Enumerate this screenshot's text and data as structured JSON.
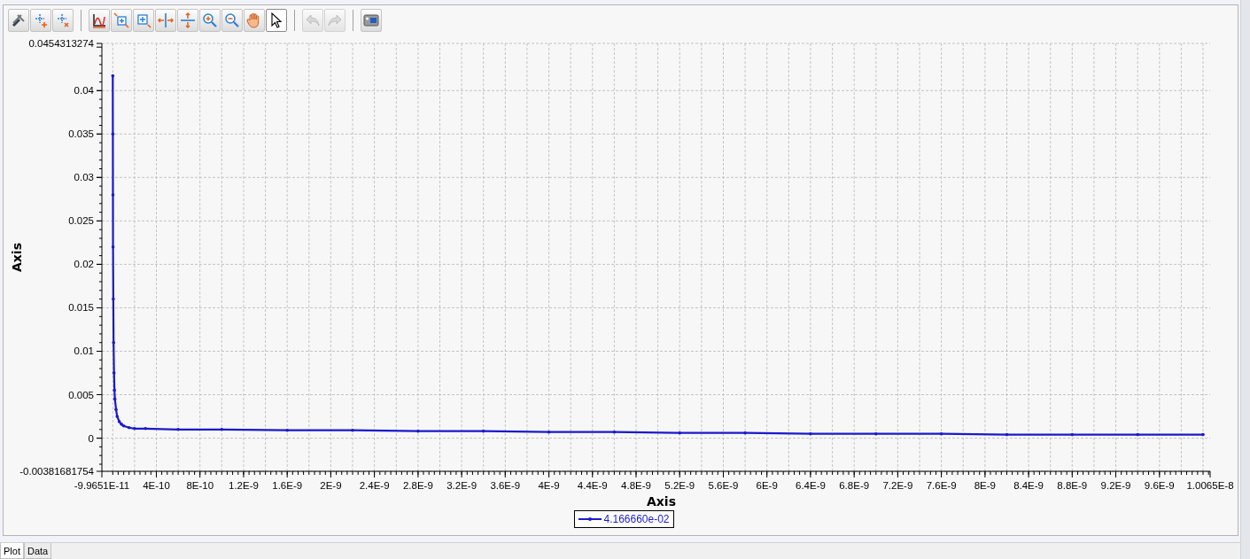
{
  "toolbar": [
    {
      "kind": "tools",
      "selected": false,
      "disabled": false
    },
    {
      "kind": "add-point",
      "selected": false,
      "disabled": false
    },
    {
      "kind": "remove-point",
      "selected": false,
      "disabled": false
    },
    {
      "kind": "sep"
    },
    {
      "kind": "axes",
      "selected": false,
      "disabled": false
    },
    {
      "kind": "zoom-box",
      "selected": false,
      "disabled": false
    },
    {
      "kind": "zoom-box-alt",
      "selected": false,
      "disabled": false
    },
    {
      "kind": "split-h",
      "selected": false,
      "disabled": false
    },
    {
      "kind": "split-v",
      "selected": false,
      "disabled": false
    },
    {
      "kind": "zoom-in",
      "selected": false,
      "disabled": false
    },
    {
      "kind": "zoom-out",
      "selected": false,
      "disabled": false
    },
    {
      "kind": "hand",
      "selected": false,
      "disabled": false
    },
    {
      "kind": "pointer",
      "selected": true,
      "disabled": false
    },
    {
      "kind": "sep"
    },
    {
      "kind": "undo",
      "selected": false,
      "disabled": true
    },
    {
      "kind": "redo",
      "selected": false,
      "disabled": true
    },
    {
      "kind": "sep"
    },
    {
      "kind": "camera",
      "selected": false,
      "disabled": false
    }
  ],
  "chart": {
    "chart_data": {
      "type": "line",
      "xlabel": "Axis",
      "ylabel": "Axis",
      "xlim": [
        -9.9651e-11,
        1.0065e-08
      ],
      "ylim": [
        -0.00381681754,
        0.0454313274
      ],
      "xticks": [
        {
          "value": -9.9651e-11,
          "label": "-9.9651E-11"
        },
        {
          "value": 4e-10,
          "label": "4E-10"
        },
        {
          "value": 8e-10,
          "label": "8E-10"
        },
        {
          "value": 1.2e-09,
          "label": "1.2E-9"
        },
        {
          "value": 1.6e-09,
          "label": "1.6E-9"
        },
        {
          "value": 2e-09,
          "label": "2E-9"
        },
        {
          "value": 2.4e-09,
          "label": "2.4E-9"
        },
        {
          "value": 2.8e-09,
          "label": "2.8E-9"
        },
        {
          "value": 3.2e-09,
          "label": "3.2E-9"
        },
        {
          "value": 3.6e-09,
          "label": "3.6E-9"
        },
        {
          "value": 4e-09,
          "label": "4E-9"
        },
        {
          "value": 4.4e-09,
          "label": "4.4E-9"
        },
        {
          "value": 4.8e-09,
          "label": "4.8E-9"
        },
        {
          "value": 5.2e-09,
          "label": "5.2E-9"
        },
        {
          "value": 5.6e-09,
          "label": "5.6E-9"
        },
        {
          "value": 6e-09,
          "label": "6E-9"
        },
        {
          "value": 6.4e-09,
          "label": "6.4E-9"
        },
        {
          "value": 6.8e-09,
          "label": "6.8E-9"
        },
        {
          "value": 7.2e-09,
          "label": "7.2E-9"
        },
        {
          "value": 7.6e-09,
          "label": "7.6E-9"
        },
        {
          "value": 8e-09,
          "label": "8E-9"
        },
        {
          "value": 8.4e-09,
          "label": "8.4E-9"
        },
        {
          "value": 8.8e-09,
          "label": "8.8E-9"
        },
        {
          "value": 9.2e-09,
          "label": "9.2E-9"
        },
        {
          "value": 9.6e-09,
          "label": "9.6E-9"
        },
        {
          "value": 1.0065e-08,
          "label": "1.0065E-8"
        }
      ],
      "yticks": [
        -0.00381681754,
        0,
        0.005,
        0.01,
        0.015,
        0.02,
        0.025,
        0.03,
        0.035,
        0.04,
        0.0454313274
      ],
      "x": [
        0,
        1e-12,
        2e-12,
        3e-12,
        5e-12,
        8e-12,
        1.2e-11,
        1.6e-11,
        2e-11,
        3e-11,
        4e-11,
        6e-11,
        8e-11,
        1e-10,
        1.5e-10,
        2e-10,
        3e-10,
        6e-10,
        1e-09,
        1.6e-09,
        2.2e-09,
        2.8e-09,
        3.4e-09,
        4e-09,
        4.6e-09,
        5.2e-09,
        5.8e-09,
        6.4e-09,
        7e-09,
        7.6e-09,
        8.2e-09,
        8.8e-09,
        9.4e-09,
        1e-08
      ],
      "series": [
        {
          "name": "4.166660e-02",
          "color": "#1a1acc",
          "values": [
            0.0417,
            0.035,
            0.028,
            0.022,
            0.016,
            0.011,
            0.0075,
            0.0055,
            0.0045,
            0.0033,
            0.0025,
            0.0019,
            0.0016,
            0.0014,
            0.0012,
            0.0011,
            0.0011,
            0.001,
            0.001,
            0.0009,
            0.0009,
            0.0008,
            0.0008,
            0.0007,
            0.0007,
            0.0006,
            0.0006,
            0.0005,
            0.0005,
            0.0005,
            0.0004,
            0.0004,
            0.0004,
            0.0004
          ]
        }
      ],
      "grid": true
    }
  },
  "tabs": [
    {
      "label": "Plot",
      "selected": true
    },
    {
      "label": "Data",
      "selected": false
    }
  ]
}
